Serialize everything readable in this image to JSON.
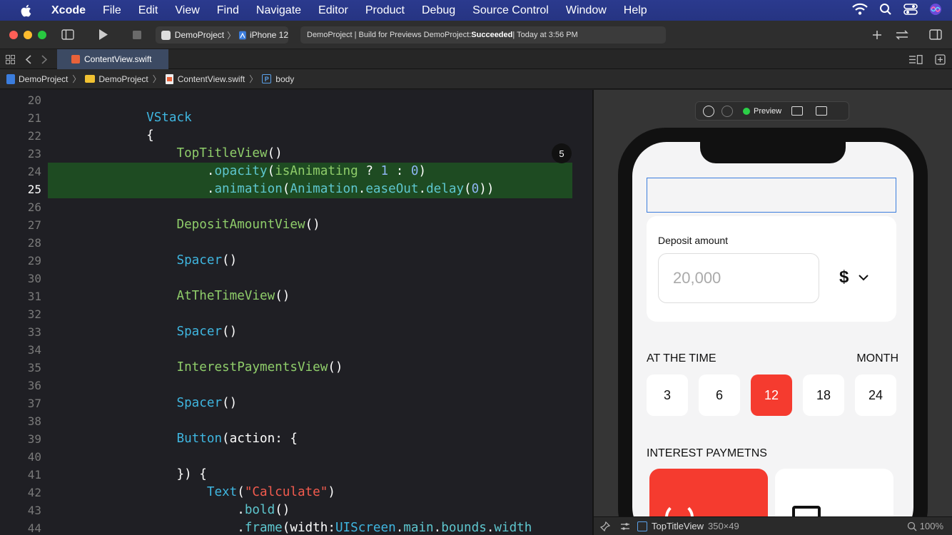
{
  "menubar": {
    "app_name": "Xcode",
    "items": [
      "File",
      "Edit",
      "View",
      "Find",
      "Navigate",
      "Editor",
      "Product",
      "Debug",
      "Source Control",
      "Window",
      "Help"
    ],
    "status_icons": [
      "wifi-icon",
      "search-icon",
      "control-center-icon",
      "siri-icon"
    ]
  },
  "toolbar": {
    "scheme": "DemoProject",
    "device": "iPhone 12",
    "activity_prefix": "DemoProject | Build for Previews DemoProject: ",
    "activity_status": "Succeeded",
    "activity_suffix": " | Today at 3:56 PM"
  },
  "tabs": [
    {
      "label": "ContentView.swift"
    }
  ],
  "jumpbar": {
    "crumbs": [
      "DemoProject",
      "DemoProject",
      "ContentView.swift",
      "body"
    ]
  },
  "editor": {
    "current_line": 25,
    "badge": "5",
    "lines": [
      {
        "n": "20",
        "text": ""
      },
      {
        "n": "21",
        "text": "            VStack"
      },
      {
        "n": "22",
        "text": "            {"
      },
      {
        "n": "23",
        "text": "                TopTitleView()"
      },
      {
        "n": "24",
        "text": "                    .opacity(isAnimating ? 1 : 0)"
      },
      {
        "n": "25",
        "text": "                    .animation(Animation.easeOut.delay(0))"
      },
      {
        "n": "26",
        "text": ""
      },
      {
        "n": "27",
        "text": "                DepositAmountView()"
      },
      {
        "n": "28",
        "text": ""
      },
      {
        "n": "29",
        "text": "                Spacer()"
      },
      {
        "n": "30",
        "text": ""
      },
      {
        "n": "31",
        "text": "                AtTheTimeView()"
      },
      {
        "n": "32",
        "text": ""
      },
      {
        "n": "33",
        "text": "                Spacer()"
      },
      {
        "n": "34",
        "text": ""
      },
      {
        "n": "35",
        "text": "                InterestPaymentsView()"
      },
      {
        "n": "36",
        "text": ""
      },
      {
        "n": "37",
        "text": "                Spacer()"
      },
      {
        "n": "38",
        "text": ""
      },
      {
        "n": "39",
        "text": "                Button(action: {"
      },
      {
        "n": "40",
        "text": ""
      },
      {
        "n": "41",
        "text": "                }) {"
      },
      {
        "n": "42",
        "text": "                    Text(\"Calculate\")"
      },
      {
        "n": "43",
        "text": "                        .bold()"
      },
      {
        "n": "44",
        "text": "                        .frame(width:UIScreen.main.bounds.width"
      }
    ]
  },
  "preview": {
    "label": "Preview",
    "deposit_label": "Deposit amount",
    "deposit_placeholder": "20,000",
    "currency": "$",
    "at_the_time": "AT THE TIME",
    "month": "MONTH",
    "months": [
      "3",
      "6",
      "12",
      "18",
      "24"
    ],
    "selected_month": "12",
    "interest_title": "INTEREST PAYMETNS"
  },
  "canvasbar": {
    "component": "TopTitleView",
    "dimensions": "350×49",
    "zoom": "100%"
  },
  "colors": {
    "accent_red": "#f53b2f",
    "highlight_green": "#1e4b22",
    "build_success": "#2bcf47"
  }
}
